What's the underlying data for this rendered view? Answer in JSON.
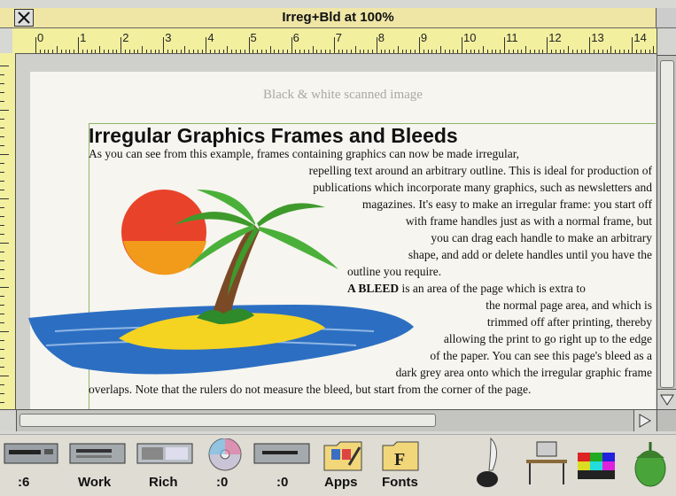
{
  "window": {
    "title": "Irreg+Bld at 100%"
  },
  "ruler": {
    "numbers": [
      "0",
      "1",
      "2",
      "3",
      "4",
      "5",
      "6",
      "7",
      "8",
      "9",
      "10",
      "11",
      "12",
      "13",
      "14"
    ]
  },
  "ghost": {
    "line1": "Black & white scanned image",
    "line2": ""
  },
  "document": {
    "headline": "Irregular Graphics Frames and Bleeds",
    "lines": [
      "As you can see from this example, frames containing graphics can now be made irregular,",
      "repelling text around an arbitrary outline.  This is ideal for production of",
      "publications which incorporate many graphics, such as newsletters and",
      "magazines.  It's easy to make an irregular frame:  you start off",
      "with frame handles just as with a normal frame, but",
      "you can drag each handle to make an arbitrary",
      "shape, and add or delete handles until you have the",
      "outline you require."
    ],
    "bleed_bold": "A BLEED",
    "bleed_lines": [
      " is an area of the page which is extra to",
      "the normal page area, and which is",
      "trimmed off after printing, thereby",
      "allowing the print to go right up to the edge",
      "of the paper.  You can see this page's bleed as a",
      "dark grey area onto which the irregular graphic frame",
      "overlaps.  Note that the rulers do not measure the bleed, but start from the corner of the page."
    ]
  },
  "iconbar": {
    "items": [
      {
        "label": ":6",
        "icon": "floppy-drive-icon"
      },
      {
        "label": "Work",
        "icon": "hard-disc-icon"
      },
      {
        "label": "Rich",
        "icon": "memory-card-icon"
      },
      {
        "label": ":0",
        "icon": "cd-rom-icon"
      },
      {
        "label": ":0",
        "icon": "disc-drive-icon"
      },
      {
        "label": "Apps",
        "icon": "apps-folder-icon"
      },
      {
        "label": "Fonts",
        "icon": "fonts-folder-icon"
      }
    ],
    "right_icons": [
      "quill-ink-icon",
      "computer-desk-icon",
      "display-palette-icon",
      "acorn-icon"
    ]
  }
}
